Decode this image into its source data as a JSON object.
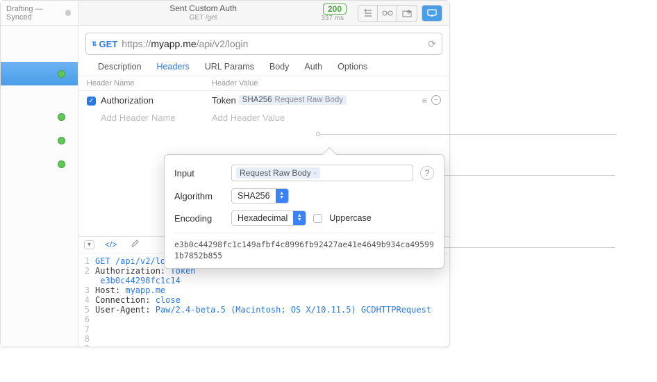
{
  "sidebar": {
    "top_label": "Drafting — Synced"
  },
  "titlebar": {
    "title": "Sent Custom Auth",
    "subtitle": "GET /get",
    "status_code": "200",
    "latency": "337 ms"
  },
  "urlbar": {
    "method": "GET",
    "scheme": "https://",
    "host": "myapp.me",
    "path": "/api/v2/login"
  },
  "tabs": {
    "description": "Description",
    "headers": "Headers",
    "url_params": "URL Params",
    "body": "Body",
    "auth": "Auth",
    "options": "Options"
  },
  "headers_table": {
    "col_name": "Header Name",
    "col_value": "Header Value",
    "row0": {
      "name": "Authorization",
      "value_prefix": "Token",
      "chip_algo": "SHA256",
      "chip_text": "Request Raw Body"
    },
    "placeholder_name": "Add Header Name",
    "placeholder_value": "Add Header Value"
  },
  "popup": {
    "input_label": "Input",
    "input_chip": "Request Raw Body",
    "algo_label": "Algorithm",
    "algo_value": "SHA256",
    "encoding_label": "Encoding",
    "encoding_value": "Hexadecimal",
    "uppercase_label": "Uppercase",
    "result": "e3b0c44298fc1c149afbf4c8996fb92427ae41e4649b934ca495991b7852b855"
  },
  "editor": {
    "tab_code": "</>",
    "lines": {
      "l1a": "GET",
      "l1b": " /api/v2/login",
      "l2a": "Authorization: ",
      "l2b": "Token",
      "l2c": " e3b0c44298fc1c14",
      "l3a": "Host: ",
      "l3b": "myapp.me",
      "l4a": "Connection: ",
      "l4b": "close",
      "l5a": "User-Agent: ",
      "l5b": "Paw/2.4-beta.5 (Macintosh; OS X/10.11.5) GCDHTTPRequest"
    }
  }
}
